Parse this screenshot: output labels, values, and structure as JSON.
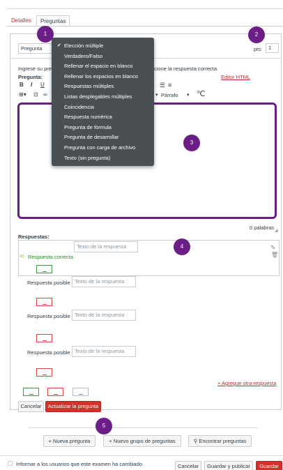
{
  "tabs": [
    {
      "label": "Detalles"
    },
    {
      "label": "Preguntas"
    }
  ],
  "question_type_select": {
    "value": "Pregunta"
  },
  "points": {
    "label": "pts:",
    "value": "1"
  },
  "instructions": {
    "text_left": "Ingrese su preg",
    "text_right": "cione la respuesta correcta."
  },
  "editor": {
    "label": "Pregunta:",
    "html_editor_link": "Editor HTML",
    "paragraph_select": "Párrafo",
    "word_count": "0 palabras"
  },
  "dropdown": {
    "items": [
      {
        "label": "Elección múltiple",
        "selected": true
      },
      {
        "label": "Verdadero/Falso"
      },
      {
        "label": "Rellenar el espacio en blanco"
      },
      {
        "label": "Rellenar los espacios en blanco"
      },
      {
        "label": "Respuestas múltiples"
      },
      {
        "label": "Listas desplegables múltiples"
      },
      {
        "label": "Coincidencia"
      },
      {
        "label": "Respuesta numérica"
      },
      {
        "label": "Pregunta de fórmula"
      },
      {
        "label": "Pregunta de desarrollar"
      },
      {
        "label": "Pregunta con carga de archivo"
      },
      {
        "label": "Texto (sin pregunta)"
      }
    ]
  },
  "badges": [
    "1",
    "2",
    "3",
    "4",
    "5"
  ],
  "answers": {
    "label": "Respuestas:",
    "correct_label": "Respuesta correcta",
    "possible_label": "Respuesta posible",
    "placeholder": "Texto de la respuesta",
    "add_link": "+ Agregue otra respuesta"
  },
  "form_buttons": {
    "cancel": "Cancelar",
    "update": "Actualizar la pregunta"
  },
  "bottom_buttons": {
    "new_question": "+ Nueva pregunta",
    "new_group": "+ Nuevo grupo de preguntas",
    "find": "Encontrar preguntas"
  },
  "footer": {
    "notify": "Informar a los usuarios que este examen ha cambiado",
    "cancel": "Cancelar",
    "save_publish": "Guardar y publicar",
    "save": "Guardar"
  },
  "colors": {
    "accent_purple": "#6b1f86",
    "danger_red": "#d3322b",
    "link_red": "#c1272d",
    "correct_green": "#2a8a2a"
  }
}
